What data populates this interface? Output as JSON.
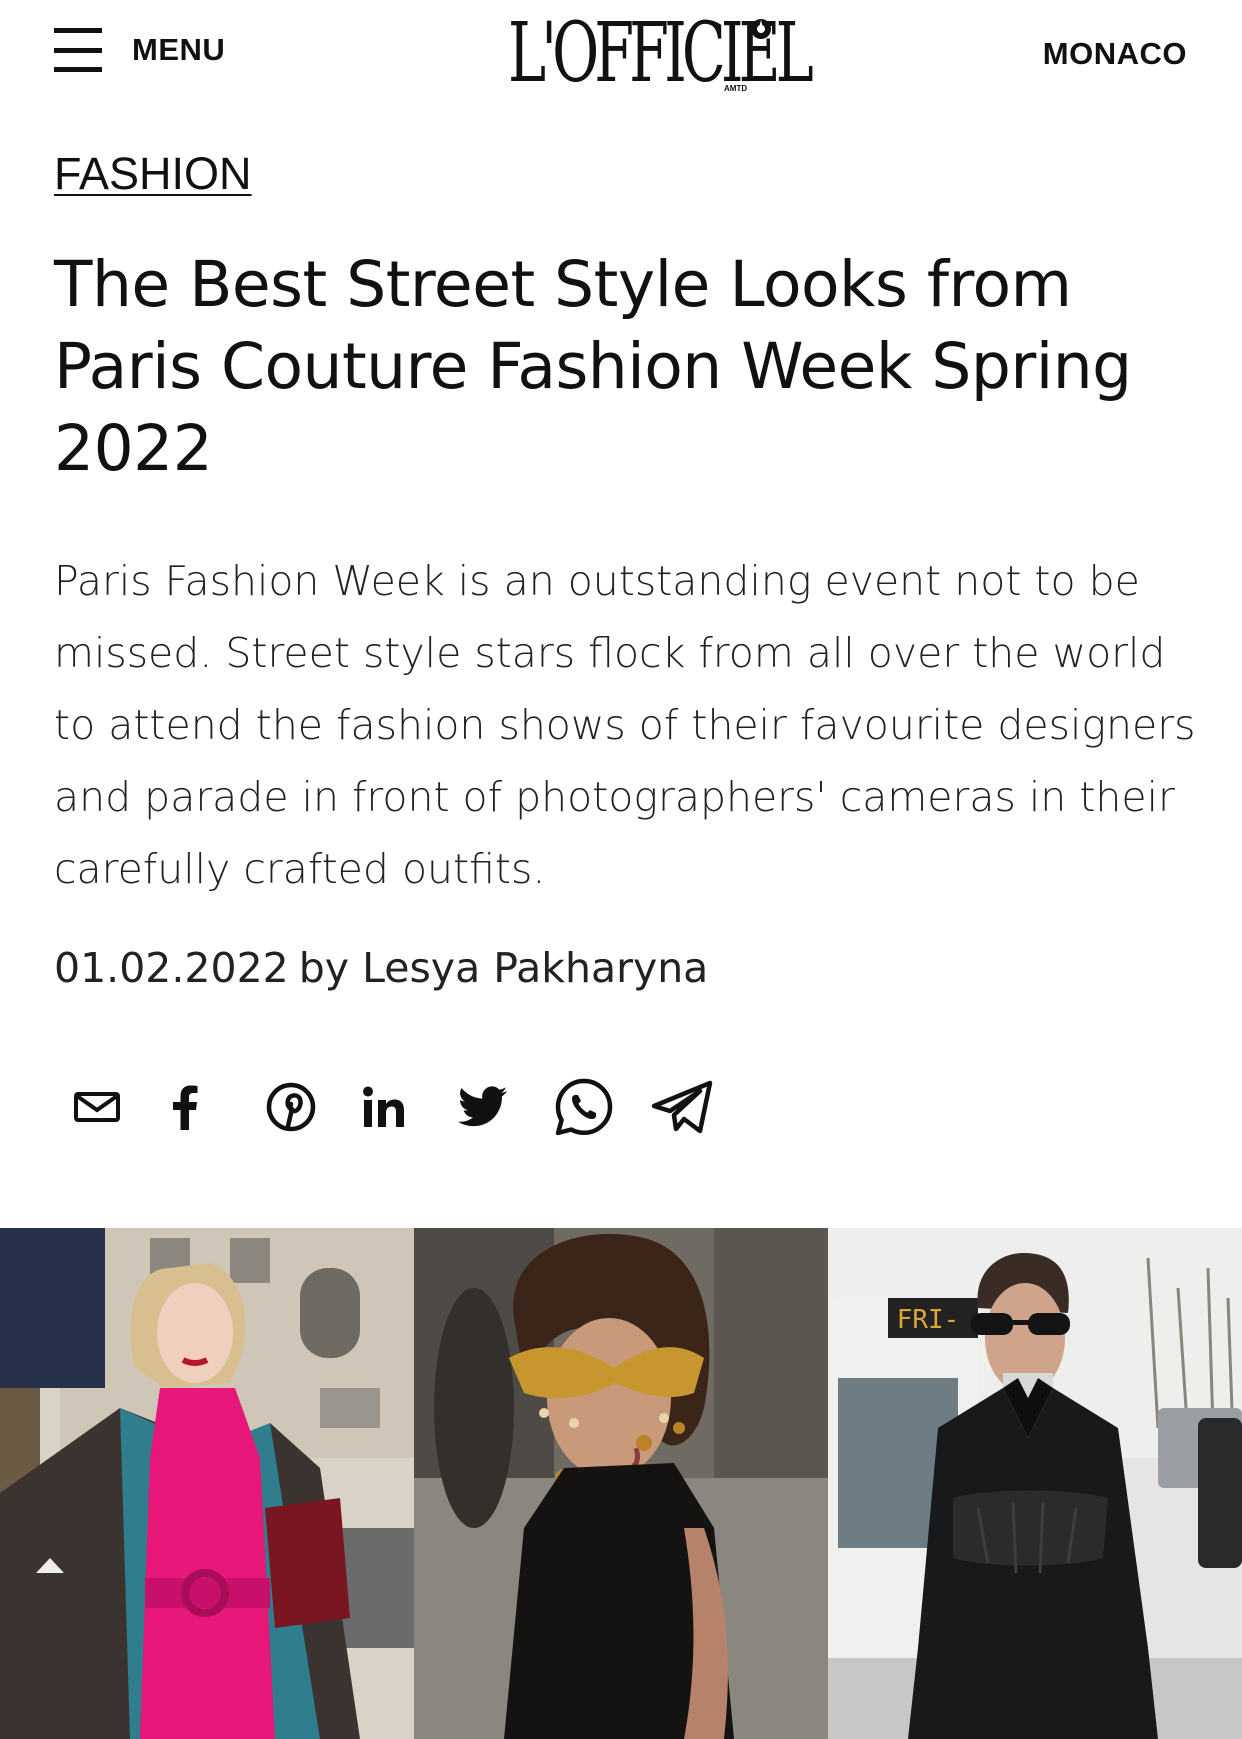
{
  "header": {
    "menu_label": "MENU",
    "logo_text": "L'OFFICIEL",
    "logo_sub": "AMTD",
    "region_label": "MONACO"
  },
  "article": {
    "category": "FASHION",
    "title": "The Best Street Style Looks from Paris Couture Fashion Week Spring 2022",
    "lead": "Paris Fashion Week is an outstanding event not to be missed. Street style stars flock from all over the world to attend the fashion shows of their favourite designers and parade in front of photographers' cameras in their carefully crafted outfits.",
    "date": "01.02.2022",
    "by": "by",
    "author": "Lesya Pakharyna"
  },
  "share": {
    "icons": [
      "mail-icon",
      "facebook-icon",
      "pinterest-icon",
      "linkedin-icon",
      "twitter-icon",
      "whatsapp-icon",
      "telegram-icon"
    ]
  },
  "gallery": {
    "photos": [
      "street-style-pink-dress",
      "street-style-gold-eyewear",
      "street-style-black-corset"
    ],
    "bus_sign": "FRI-"
  },
  "colors": {
    "text": "#111111",
    "accent_pink": "#e8177a",
    "background": "#ffffff"
  }
}
